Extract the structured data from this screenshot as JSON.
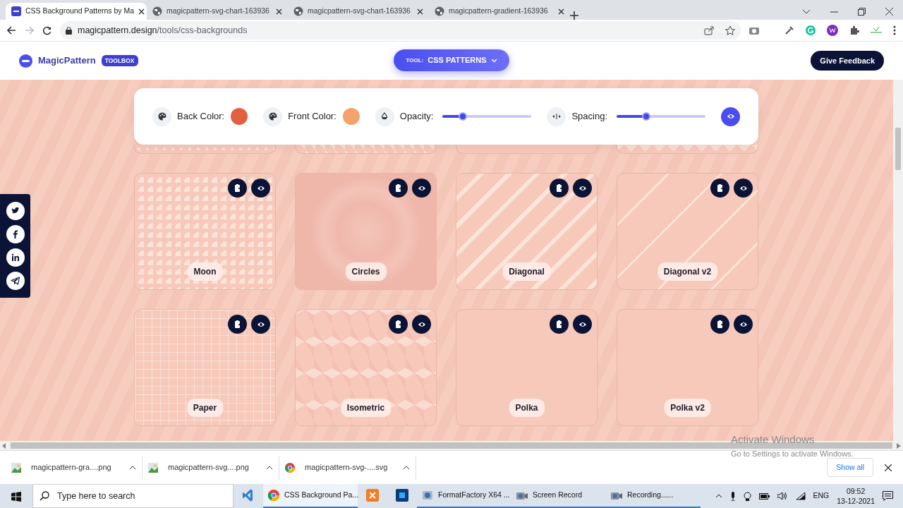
{
  "browser": {
    "tabs": [
      {
        "title": "CSS Background Patterns by Ma",
        "selected": true
      },
      {
        "title": "magicpattern-svg-chart-163936",
        "selected": false
      },
      {
        "title": "magicpattern-svg-chart-163936",
        "selected": false
      },
      {
        "title": "magicpattern-gradient-163936",
        "selected": false
      }
    ],
    "address_host": "magicpattern.design",
    "address_path": "/tools/css-backgrounds"
  },
  "header": {
    "brand": "MagicPattern",
    "badge": "TOOLBOX",
    "tool_label": "TOOL:",
    "tool_value": "CSS PATTERNS",
    "feedback": "Give Feedback"
  },
  "controls": {
    "swatches": [
      {
        "label": "Back Color:",
        "color": "#e2603f"
      },
      {
        "label": "Front Color:",
        "color": "#f4a26b"
      }
    ],
    "opacity_label": "Opacity:",
    "opacity": {
      "level": 0.23
    },
    "spacing_label": "Spacing:",
    "spacing": {
      "level": 0.33
    }
  },
  "patterns": [
    {
      "kind": "dots"
    },
    {
      "kind": "diamonds"
    },
    {
      "kind": "plain"
    },
    {
      "kind": "zigzag"
    },
    {
      "name": "Moon",
      "kind": "moon"
    },
    {
      "name": "Circles",
      "kind": "circles"
    },
    {
      "name": "Diagonal",
      "kind": "diagonal"
    },
    {
      "name": "Diagonal v2",
      "kind": "diagonal2"
    },
    {
      "name": "Paper",
      "kind": "paper"
    },
    {
      "name": "Isometric",
      "kind": "isometric"
    },
    {
      "name": "Polka",
      "kind": "plain"
    },
    {
      "name": "Polka v2",
      "kind": "plain"
    }
  ],
  "social": [
    {
      "kind": "twitter"
    },
    {
      "kind": "facebook"
    },
    {
      "kind": "linkedin"
    },
    {
      "kind": "telegram"
    }
  ],
  "downloads": {
    "items": [
      {
        "file": "magicpattern-gra....png",
        "kind": "image"
      },
      {
        "file": "magicpattern-svg....png",
        "kind": "image"
      },
      {
        "file": "magicpattern-svg-....svg",
        "kind": "chrome"
      }
    ],
    "show_all": "Show all"
  },
  "os_notice": {
    "title": "Activate Windows",
    "subtitle": "Go to Settings to activate Windows."
  },
  "taskbar": {
    "search_placeholder": "Type here to search",
    "apps": [
      {
        "kind": "vscode",
        "selected": false
      },
      {
        "kind": "chrome",
        "label": "CSS Background Pa...",
        "selected": true
      },
      {
        "kind": "xampp",
        "selected": false
      },
      {
        "kind": "ps",
        "selected": false
      },
      {
        "kind": "factory",
        "label": "FormatFactory X64 ...",
        "selected": false
      },
      {
        "kind": "camera",
        "label": "Screen Record",
        "selected": false
      },
      {
        "kind": "camera",
        "label": "Recording......",
        "selected": false
      }
    ],
    "language": "ENG",
    "time": "09:52",
    "date": "13-12-2021"
  }
}
